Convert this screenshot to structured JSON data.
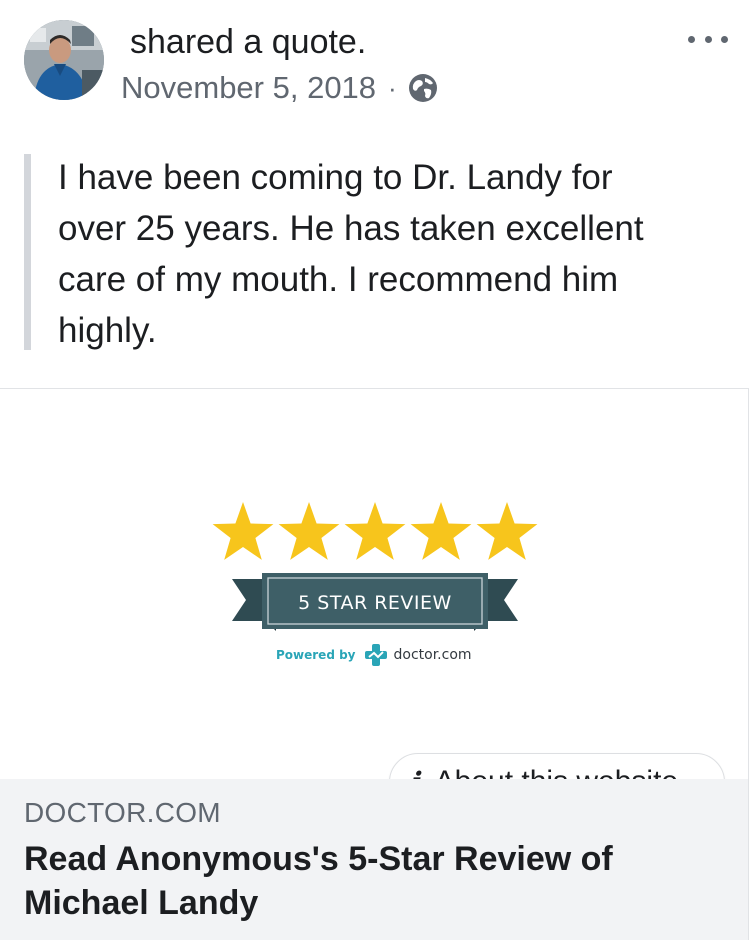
{
  "post": {
    "action_text": "shared a quote.",
    "date": "November 5, 2018",
    "separator": "·",
    "privacy_icon": "globe-icon",
    "more_icon": "more-options-icon",
    "quote": "I have been coming to Dr. Landy for\nover 25 years.  He has taken excellent\ncare of my mouth.  I recommend him\nhighly."
  },
  "card": {
    "image": {
      "stars": 5,
      "banner_text": "5 STAR REVIEW",
      "powered_by": "Powered by",
      "brand": "doctor.com"
    },
    "about_label": "About this website",
    "domain": "DOCTOR.COM",
    "title": "Read Anonymous's 5-Star Review of Michael Landy"
  },
  "colors": {
    "star": "#f7c51c",
    "banner": "#3e5f67",
    "powered": "#2aa5b7",
    "meta_text": "#606770",
    "footer_bg": "#f2f3f5"
  }
}
